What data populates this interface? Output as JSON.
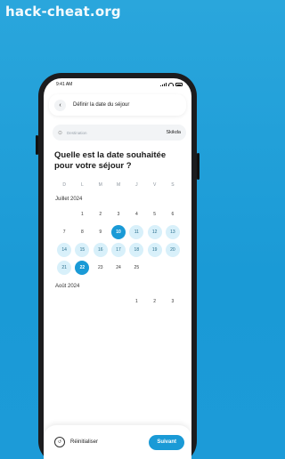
{
  "watermark": "hack-cheat.org",
  "status": {
    "time": "9:41 AM"
  },
  "header": {
    "title": "Définir la date du séjour",
    "back_icon": "chevron-left-icon"
  },
  "destination": {
    "placeholder": "Destination",
    "value": "Skikda"
  },
  "question": "Quelle est la date souhaitée pour votre séjour ?",
  "calendar": {
    "weekdays": [
      "D",
      "L",
      "M",
      "M",
      "J",
      "V",
      "S"
    ],
    "months": [
      {
        "label": "Juillet 2024",
        "days": [
          "",
          "1",
          "2",
          "3",
          "4",
          "5",
          "6",
          "7",
          "8",
          "9",
          "10",
          "11",
          "12",
          "13",
          "14",
          "15",
          "16",
          "17",
          "18",
          "19",
          "20",
          "21",
          "22",
          "23",
          "24",
          "25"
        ],
        "selected": [
          "10",
          "22"
        ],
        "in_range": [
          "11",
          "12",
          "13",
          "14",
          "15",
          "16",
          "17",
          "18",
          "19",
          "20",
          "21"
        ]
      },
      {
        "label": "Août 2024",
        "days": [
          "",
          "",
          "",
          "",
          "1",
          "2",
          "3"
        ],
        "selected": [],
        "in_range": []
      }
    ]
  },
  "footer": {
    "reset_label": "Réinitialiser",
    "next_label": "Suivant"
  },
  "colors": {
    "accent": "#1a9ad6",
    "range": "#d8f0fa"
  }
}
